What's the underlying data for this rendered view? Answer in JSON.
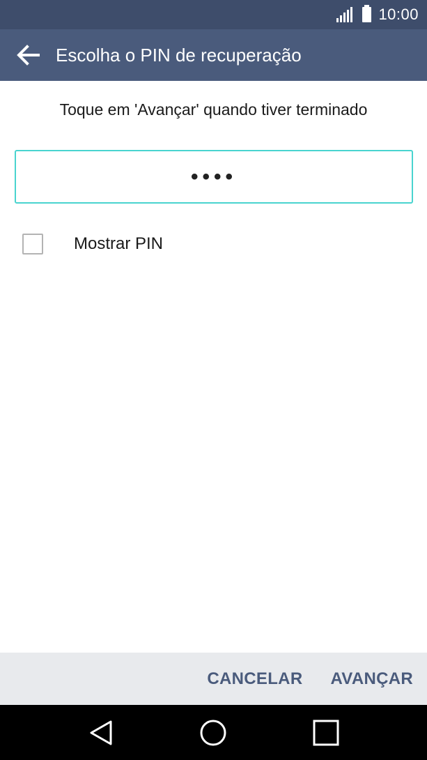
{
  "status_bar": {
    "time": "10:00",
    "signal_icon": "signal-icon",
    "battery_icon": "battery-icon"
  },
  "app_bar": {
    "back_icon": "back-arrow-icon",
    "title": "Escolha o PIN de recuperação"
  },
  "content": {
    "instruction": "Toque em 'Avançar' quando tiver terminado",
    "pin_field": {
      "masked_value": "••••"
    },
    "show_pin": {
      "label": "Mostrar PIN",
      "checked": false
    }
  },
  "actions": {
    "cancel_label": "CANCELAR",
    "next_label": "AVANÇAR"
  },
  "nav_bar": {
    "back_icon": "triangle-back-icon",
    "home_icon": "circle-home-icon",
    "recents_icon": "square-recents-icon"
  },
  "colors": {
    "status_bar": "#3e4d6b",
    "app_bar": "#4a5b7c",
    "field_border": "#49d4cf",
    "action_text": "#4a5b7c",
    "action_bar_bg": "#e8eaed",
    "nav_bar_bg": "#000000"
  }
}
